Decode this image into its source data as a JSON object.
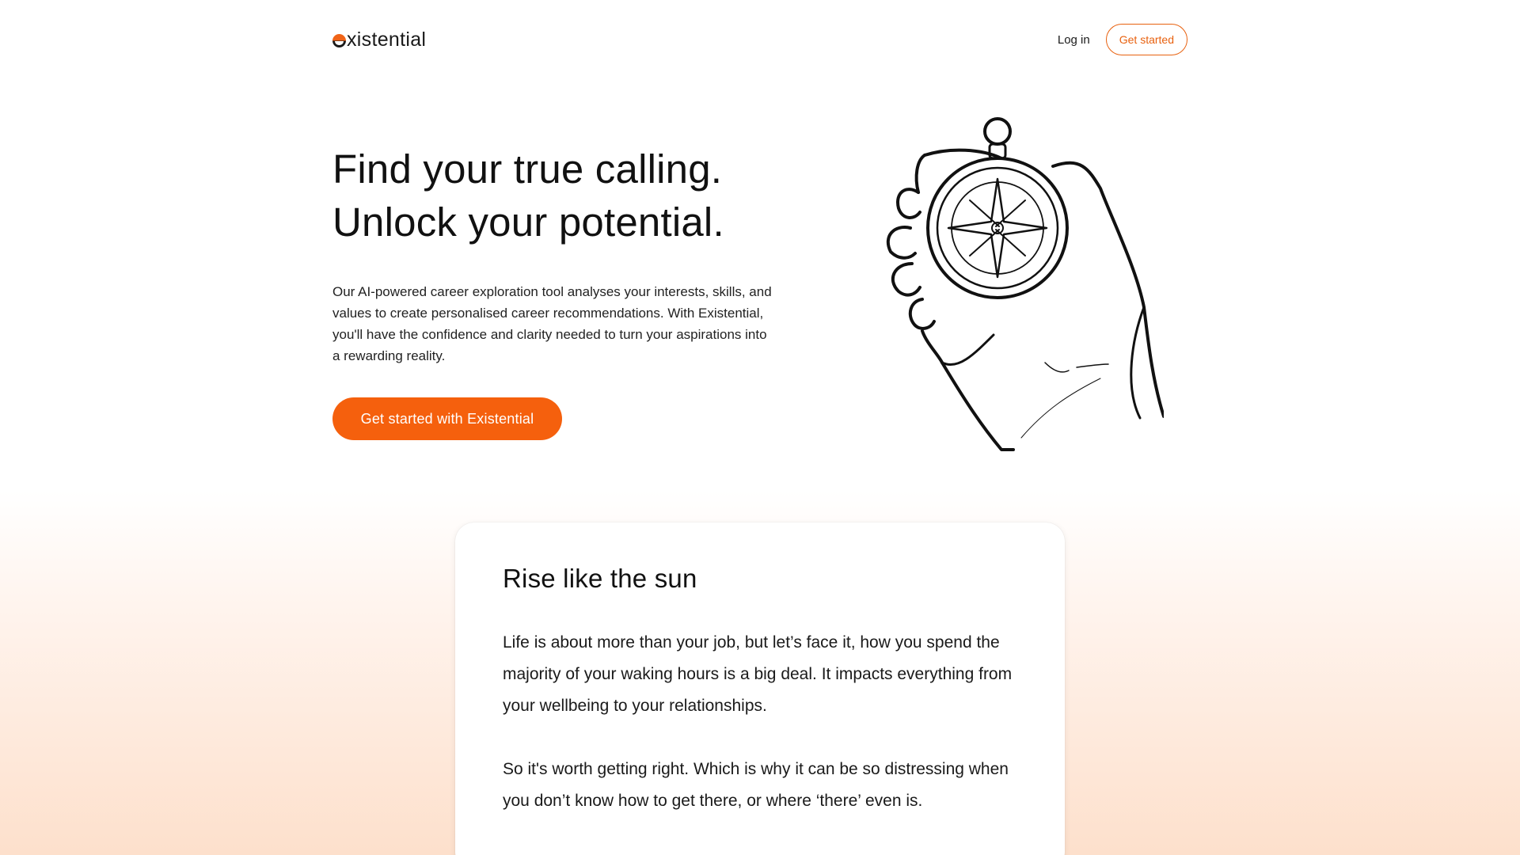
{
  "brand": {
    "name": "xistential",
    "accent": "#f5600d"
  },
  "nav": {
    "login_label": "Log in",
    "get_started_label": "Get started"
  },
  "hero": {
    "title_line1": "Find your true calling.",
    "title_line2": "Unlock your potential.",
    "description": "Our AI-powered career exploration tool analyses your interests, skills, and values to create personalised career recommendations. With Existential, you'll have the confidence and clarity needed to turn your aspirations into a rewarding reality.",
    "cta_label": "Get started with Existential"
  },
  "card": {
    "title": "Rise like the sun",
    "paragraph1": "Life is about more than your job, but let’s face it, how you spend the majority of your waking hours is a big deal. It impacts everything from your wellbeing to your relationships.",
    "paragraph2": "So it's worth getting right. Which is why it can be so distressing when you don’t know how to get there, or where ‘there’ even is."
  }
}
